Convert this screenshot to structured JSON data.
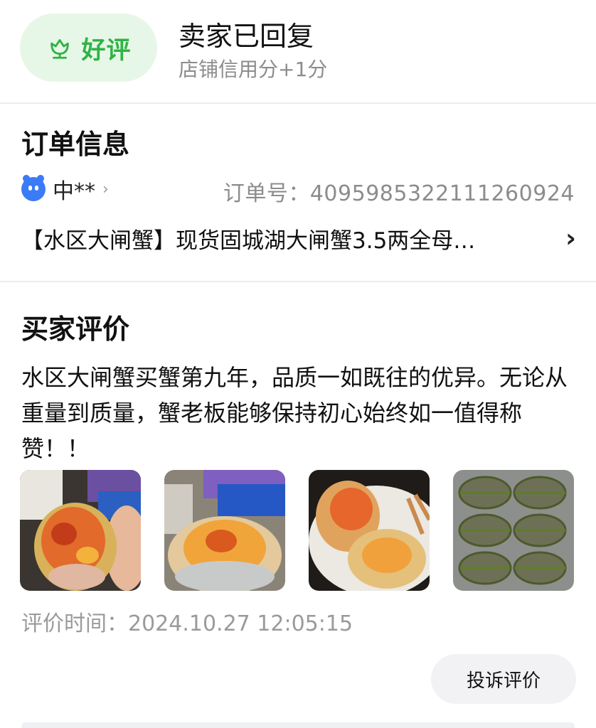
{
  "header": {
    "rating_label": "好评",
    "rating_icon": "tulip-icon",
    "reply_title": "卖家已回复",
    "reply_subtitle": "店铺信用分+1分",
    "accent_color": "#2fb344",
    "pill_bg": "#e6f7e7"
  },
  "order": {
    "section_title": "订单信息",
    "shop_name": "中**",
    "order_number_label": "订单号：",
    "order_number": "4095985322111260924",
    "order_number_text": "订单号：4095985322111260924",
    "product_title": "【水区大闸蟹】现货固城湖大闸蟹3.5两全母…"
  },
  "review": {
    "section_title": "买家评价",
    "text": "水区大闸蟹买蟹第九年，品质一如既往的优异。无论从重量到质量，蟹老板能够保持初心始终如一值得称赞！！",
    "photos": [
      {
        "icon": "crab-opened-photo"
      },
      {
        "icon": "crab-roe-photo"
      },
      {
        "icon": "crab-plate-photo"
      },
      {
        "icon": "tied-crabs-photo"
      }
    ],
    "time_label": "评价时间：",
    "time_value": "2024.10.27 12:05:15",
    "time_text": "评价时间：2024.10.27 12:05:15",
    "complain_button": "投诉评价"
  }
}
